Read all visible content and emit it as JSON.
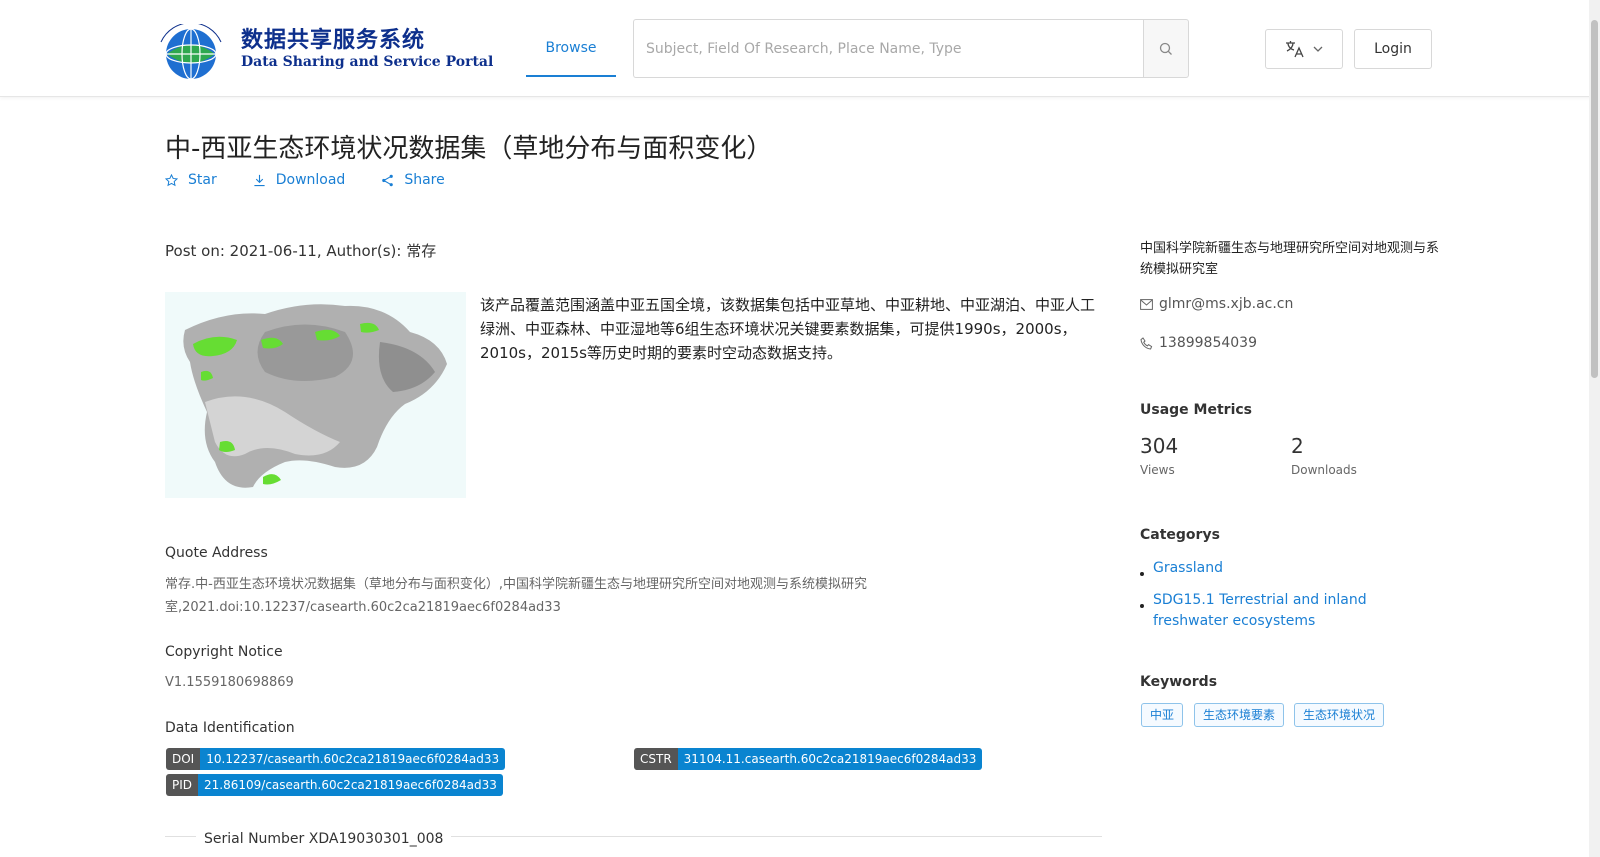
{
  "header": {
    "logo_cn": "数据共享服务系统",
    "logo_en": "Data Sharing and Service Portal",
    "nav_browse": "Browse",
    "search_placeholder": "Subject, Field Of Research, Place Name, Type",
    "search_value": "",
    "login_label": "Login"
  },
  "dataset": {
    "title": "中-西亚生态环境状况数据集（草地分布与面积变化）",
    "actions": [
      "Star",
      "Download",
      "Share"
    ],
    "post_line": "Post on: 2021-06-11, Author(s): 常存",
    "description": "该产品覆盖范围涵盖中亚五国全境，该数据集包括中亚草地、中亚耕地、中亚湖泊、中亚人工绿洲、中亚森林、中亚湿地等6组生态环境状况关键要素数据集，可提供1990s，2000s，2010s，2015s等历史时期的要素时空动态数据支持。",
    "quote_label": "Quote Address",
    "quote_text": "常存.中-西亚生态环境状况数据集（草地分布与面积变化）,中国科学院新疆生态与地理研究所空间对地观测与系统模拟研究室,2021.doi:10.12237/casearth.60c2ca21819aec6f0284ad33",
    "copyright_label": "Copyright Notice",
    "copyright_text": "V1.1559180698869",
    "identification_label": "Data Identification",
    "identifiers": {
      "doi": {
        "key": "DOI",
        "value": "10.12237/casearth.60c2ca21819aec6f0284ad33"
      },
      "cstr": {
        "key": "CSTR",
        "value": "31104.11.casearth.60c2ca21819aec6f0284ad33"
      },
      "pid": {
        "key": "PID",
        "value": "21.86109/casearth.60c2ca21819aec6f0284ad33"
      }
    },
    "serial": "Serial Number XDA19030301_008"
  },
  "sidebar": {
    "organization": "中国科学院新疆生态与地理研究所空间对地观测与系统模拟研究室",
    "email": "glmr@ms.xjb.ac.cn",
    "phone": "13899854039",
    "usage_heading": "Usage Metrics",
    "views_count": "304",
    "views_label": "Views",
    "downloads_count": "2",
    "downloads_label": "Downloads",
    "categories_heading": "Categorys",
    "categories": [
      "Grassland",
      "SDG15.1 Terrestrial and inland freshwater ecosystems"
    ],
    "keywords_heading": "Keywords",
    "keywords": [
      "中亚",
      "生态环境要素",
      "生态环境状况"
    ]
  },
  "colors": {
    "accent": "#1a7fd4",
    "badge_value": "#0a84d0",
    "badge_key": "#555555",
    "grass_green": "#66dd33"
  },
  "icons": {
    "search": "search-icon",
    "translate": "translate-icon",
    "star": "star-icon",
    "download": "download-icon",
    "share": "share-icon",
    "mail": "mail-icon",
    "phone": "phone-icon"
  }
}
